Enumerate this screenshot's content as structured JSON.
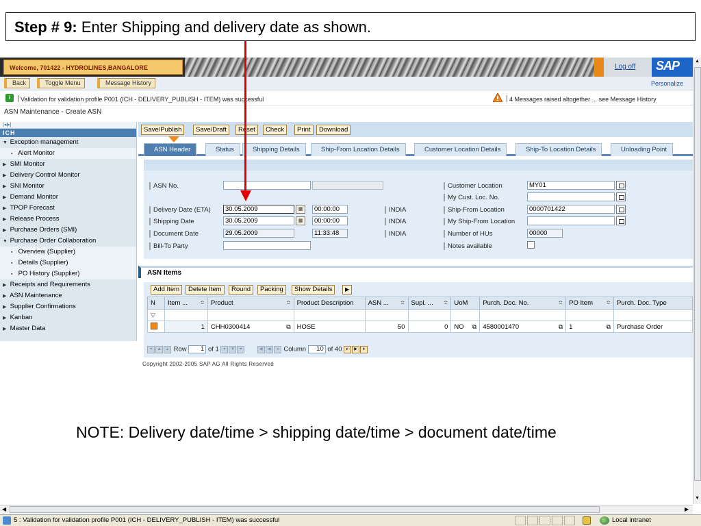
{
  "slide": {
    "step_label": "Step # 9:",
    "step_text": "Enter Shipping and delivery date as shown.",
    "note": "NOTE: Delivery date/time > shipping date/time > document date/time"
  },
  "header": {
    "welcome": "Welcome, 701422 - HYDROLINES,BANGALORE",
    "logoff": "Log off",
    "logo_text": "SAP"
  },
  "toolbar": {
    "back": "Back",
    "toggle_menu": "Toggle Menu",
    "message_history": "Message History",
    "personalize": "Personalize"
  },
  "messages": {
    "success": "Validation for validation profile P001 (ICH - DELIVERY_PUBLISH - ITEM) was successful",
    "warning": "4 Messages raised altogether ... see Message History"
  },
  "page_title": "ASN Maintenance - Create ASN",
  "nav": {
    "header": "ICH",
    "items": [
      {
        "label": "Exception management",
        "level": 0,
        "open": true
      },
      {
        "label": "Alert Monitor",
        "level": 1
      },
      {
        "label": "SMI Monitor",
        "level": 0
      },
      {
        "label": "Delivery Control Monitor",
        "level": 0
      },
      {
        "label": "SNI Monitor",
        "level": 0
      },
      {
        "label": "Demand Monitor",
        "level": 0
      },
      {
        "label": "TPOP Forecast",
        "level": 0
      },
      {
        "label": "Release Process",
        "level": 0
      },
      {
        "label": "Purchase Orders (SMI)",
        "level": 0
      },
      {
        "label": "Purchase Order Collaboration",
        "level": 0,
        "open": true
      },
      {
        "label": "Overview (Supplier)",
        "level": 1
      },
      {
        "label": "Details (Supplier)",
        "level": 1
      },
      {
        "label": "PO History (Supplier)",
        "level": 1
      },
      {
        "label": "Receipts and Requirements",
        "level": 0
      },
      {
        "label": "ASN Maintenance",
        "level": 0
      },
      {
        "label": "Supplier Confirmations",
        "level": 0
      },
      {
        "label": "Kanban",
        "level": 0
      },
      {
        "label": "Master Data",
        "level": 0
      }
    ]
  },
  "actions": {
    "save_publish": "Save/Publish",
    "save_draft": "Save/Draft",
    "reset": "Reset",
    "check": "Check",
    "print": "Print",
    "download": "Download"
  },
  "tabs": [
    {
      "label": "ASN Header",
      "active": true
    },
    {
      "label": "Status"
    },
    {
      "label": "Shipping Details"
    },
    {
      "label": "Ship-From Location Details"
    },
    {
      "label": "Customer Location Details"
    },
    {
      "label": "Ship-To Location Details"
    },
    {
      "label": "Unloading Point"
    }
  ],
  "form": {
    "asn_no_label": "ASN No.",
    "asn_no_value": "",
    "delivery_date_label": "Delivery Date (ETA)",
    "delivery_date_value": "30.05.2009",
    "delivery_time_value": "00:00:00",
    "delivery_tz": "INDIA",
    "shipping_date_label": "Shipping Date",
    "shipping_date_value": "30.05.2009",
    "shipping_time_value": "00:00:00",
    "shipping_tz": "INDIA",
    "document_date_label": "Document Date",
    "document_date_value": "29.05.2009",
    "document_time_value": "11:33:48",
    "document_tz": "INDIA",
    "bill_to_label": "Bill-To Party",
    "bill_to_value": "",
    "customer_location_label": "Customer Location",
    "customer_location_value": "MY01",
    "my_cust_loc_label": "My Cust. Loc. No.",
    "my_cust_loc_value": "",
    "ship_from_label": "Ship-From Location",
    "ship_from_value": "0000701422",
    "my_ship_from_label": "My Ship-From Location",
    "my_ship_from_value": "",
    "num_hus_label": "Number of HUs",
    "num_hus_value": "00000",
    "notes_label": "Notes available"
  },
  "items": {
    "title": "ASN Items",
    "buttons": {
      "add_item": "Add Item",
      "delete_item": "Delete Item",
      "round": "Round",
      "packing": "Packing",
      "show_details": "Show Details"
    },
    "columns": [
      "N",
      "Item ...",
      "Product",
      "Product Description",
      "ASN ...",
      "Supl. ...",
      "UoM",
      "Purch. Doc. No.",
      "PO Item",
      "Purch. Doc. Type"
    ],
    "rows": [
      {
        "item": "1",
        "product": "CHH0300414",
        "description": "HOSE",
        "asn_qty": "50",
        "supl_qty": "0",
        "uom": "NO",
        "po_no": "4580001470",
        "po_item": "1",
        "po_type": "Purchase Order"
      }
    ],
    "pager": {
      "row_label": "Row",
      "row_value": "1",
      "row_of": "of 1",
      "column_label": "Column",
      "column_value": "10",
      "column_of": "of 40"
    }
  },
  "copyright": "Copyright 2002-2005 SAP AG All Rights Reserved",
  "statusbar": {
    "text": "5 : Validation for validation profile P001 (ICH - DELIVERY_PUBLISH - ITEM) was successful",
    "zone": "Local intranet"
  }
}
